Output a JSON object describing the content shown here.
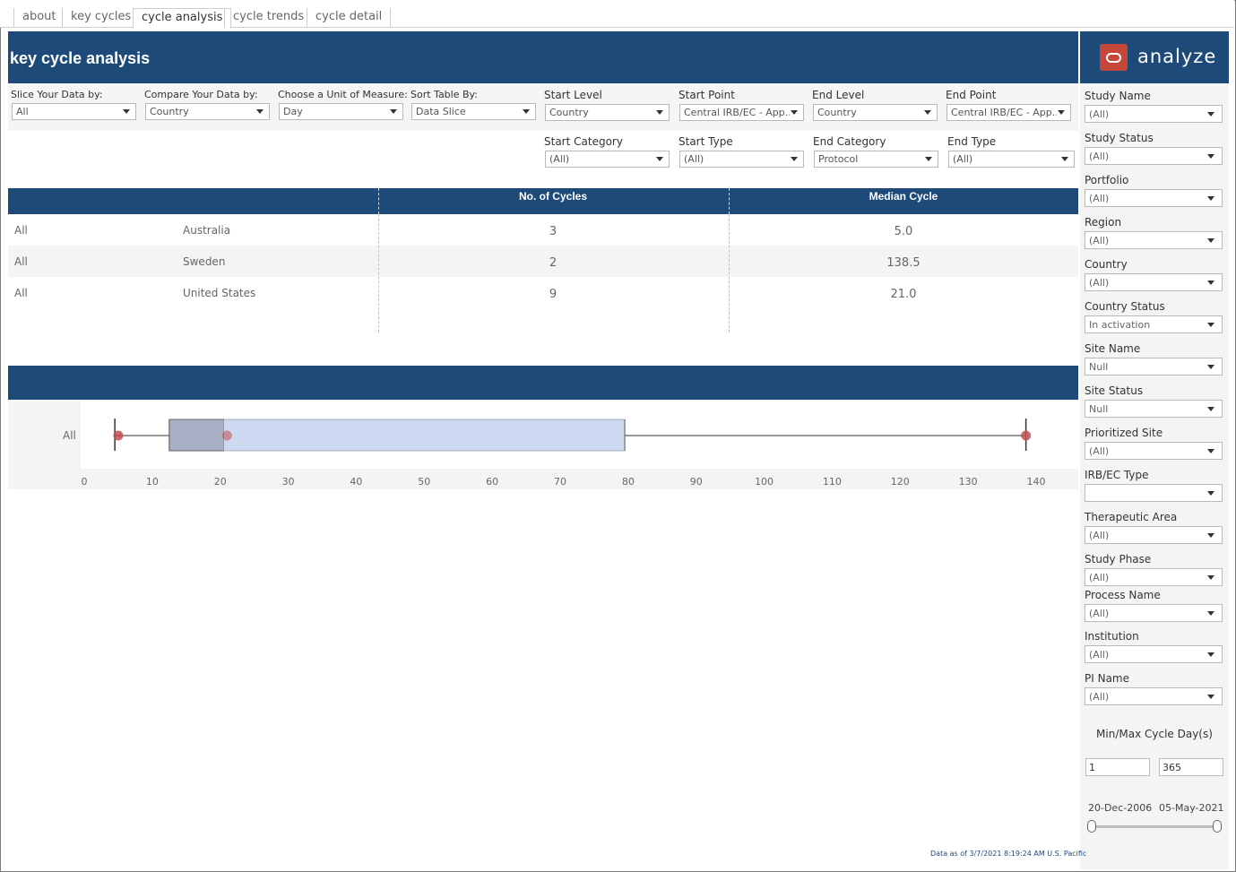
{
  "tabs": [
    {
      "label": "about",
      "active": false
    },
    {
      "label": "key cycles",
      "active": false
    },
    {
      "label": "cycle analysis",
      "active": true
    },
    {
      "label": "cycle trends",
      "active": false
    },
    {
      "label": "cycle detail",
      "active": false
    }
  ],
  "header": {
    "title": "key cycle analysis"
  },
  "brand": {
    "name": "analyze",
    "logo_icon": "oracle-logo-icon"
  },
  "filters": {
    "slice": {
      "label": "Slice Your Data by:",
      "value": "All"
    },
    "compare": {
      "label": "Compare Your Data by:",
      "value": "Country"
    },
    "unit": {
      "label": "Choose a Unit of Measure:",
      "value": "Day"
    },
    "sort": {
      "label": "Sort Table By:",
      "value": "Data Slice"
    },
    "start_level": {
      "label": "Start Level",
      "value": "Country"
    },
    "start_point": {
      "label": "Start Point",
      "value": "Central IRB/EC - App..."
    },
    "end_level": {
      "label": "End Level",
      "value": "Country"
    },
    "end_point": {
      "label": "End Point",
      "value": "Central IRB/EC - App..."
    },
    "start_category": {
      "label": "Start Category",
      "value": "(All)"
    },
    "start_type": {
      "label": "Start Type",
      "value": "(All)"
    },
    "end_category": {
      "label": "End Category",
      "value": "Protocol"
    },
    "end_type": {
      "label": "End Type",
      "value": "(All)"
    }
  },
  "table": {
    "headers": {
      "cycles": "No. of Cycles",
      "median": "Median Cycle"
    },
    "rows": [
      {
        "slice": "All",
        "country": "Australia",
        "cycles": "3",
        "median": "5.0"
      },
      {
        "slice": "All",
        "country": "Sweden",
        "cycles": "2",
        "median": "138.5"
      },
      {
        "slice": "All",
        "country": "United States",
        "cycles": "9",
        "median": "21.0"
      }
    ]
  },
  "chart_data": {
    "type": "boxplot",
    "title": "",
    "categories": [
      "All"
    ],
    "x_ticks": [
      "0",
      "10",
      "20",
      "30",
      "40",
      "50",
      "60",
      "70",
      "80",
      "90",
      "100",
      "110",
      "120",
      "130",
      "140"
    ],
    "xlim": [
      0,
      140
    ],
    "box": {
      "min": 4.5,
      "q1": 12.5,
      "median": 20.5,
      "q3": 79.5,
      "max": 138.5
    },
    "points": [
      5,
      21,
      138.5
    ],
    "colors": {
      "box_lower": "#a9b0c6",
      "box_upper": "#cdd9f0",
      "point": "#c0504d"
    }
  },
  "sidebar": {
    "filters": [
      {
        "label": "Study Name",
        "value": "(All)"
      },
      {
        "label": "Study Status",
        "value": "(All)"
      },
      {
        "label": "Portfolio",
        "value": "(All)"
      },
      {
        "label": "Region",
        "value": "(All)"
      },
      {
        "label": "Country",
        "value": "(All)"
      },
      {
        "label": "Country Status",
        "value": "In activation"
      },
      {
        "label": "Site Name",
        "value": "Null"
      },
      {
        "label": "Site Status",
        "value": "Null"
      },
      {
        "label": "Prioritized Site",
        "value": "(All)"
      },
      {
        "label": "IRB/EC Type",
        "value": ""
      },
      {
        "label": "Therapeutic Area",
        "value": "(All)"
      },
      {
        "label": "Study Phase",
        "value": "(All)"
      },
      {
        "label": "Process Name",
        "value": "(All)"
      },
      {
        "label": "Institution",
        "value": "(All)"
      },
      {
        "label": "PI Name",
        "value": "(All)"
      }
    ],
    "minmax": {
      "label": "Min/Max Cycle Day(s)",
      "min": "1",
      "max": "365"
    },
    "date_range": {
      "start": "20-Dec-2006",
      "end": "05-May-2021"
    }
  },
  "footnote": "Data as of 3/7/2021 8:19:24 AM U.S. Pacific",
  "colors": {
    "header_blue": "#1e4a79",
    "brand_red": "#c7463a"
  }
}
